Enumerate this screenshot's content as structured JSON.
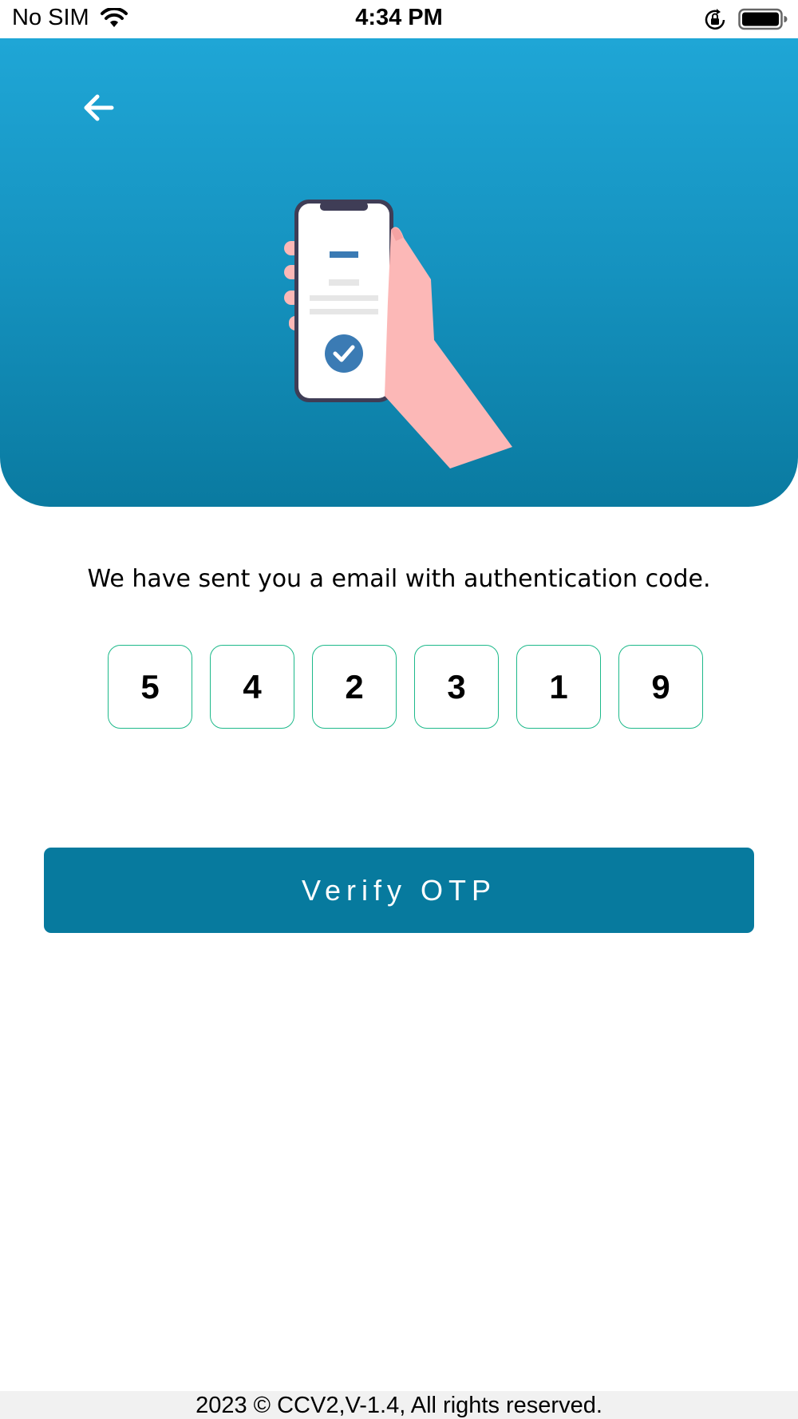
{
  "status_bar": {
    "carrier": "No SIM",
    "time": "4:34 PM",
    "icons": [
      "wifi-icon",
      "orientation-lock-icon",
      "battery-icon"
    ]
  },
  "header": {
    "back_icon": "arrow-left-icon",
    "illustration": "hand-holding-phone-check-illustration",
    "colors": {
      "gradient_top": "#1fa6d6",
      "gradient_bottom": "#0a7aa0"
    }
  },
  "main": {
    "message": "We have sent you a email with authentication code.",
    "otp_digits": [
      "5",
      "4",
      "2",
      "3",
      "1",
      "9"
    ],
    "otp_border_color": "#1db98a",
    "verify_button_label": "Verify OTP",
    "verify_button_color": "#077a9e"
  },
  "footer": {
    "text": "2023 © CCV2,V-1.4, All rights reserved."
  }
}
